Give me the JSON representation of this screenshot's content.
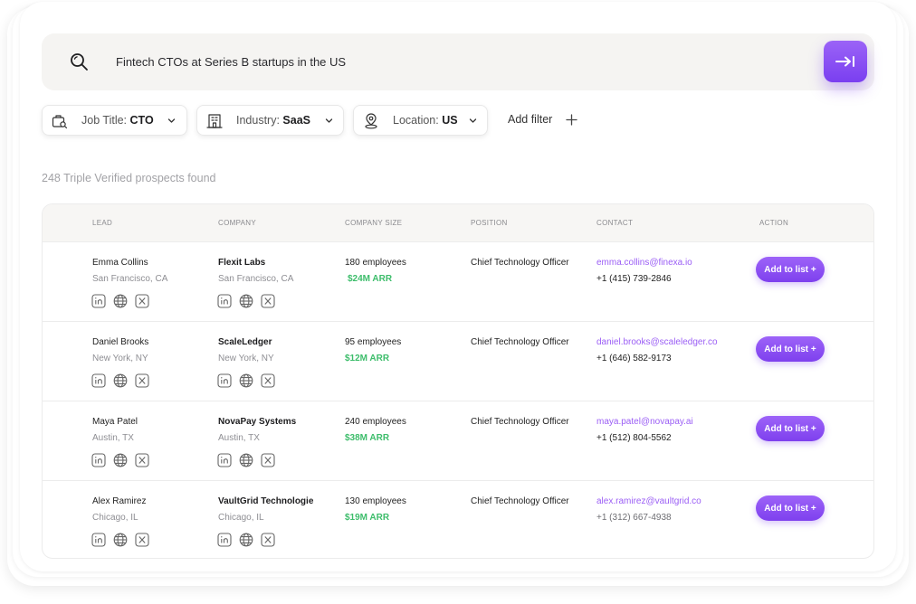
{
  "search": {
    "query": "Fintech CTOs at Series B startups in the US"
  },
  "filters": [
    {
      "label": "Job Title:",
      "value": "CTO",
      "icon": "briefcase-search-icon"
    },
    {
      "label": "Industry:",
      "value": "SaaS",
      "icon": "building-icon"
    },
    {
      "label": "Location:",
      "value": "US",
      "icon": "location-pin-icon"
    }
  ],
  "add_filter_label": "Add filter",
  "results_text": "248 Triple Verified prospects found",
  "table": {
    "headers": [
      "LEAD",
      "COMPANY",
      "COMPANY SIZE",
      "POSITION",
      "CONTACT",
      "ACTION"
    ],
    "rows": [
      {
        "name": "Emma Collins",
        "location": "San Francisco, CA",
        "company": "Flexit Labs",
        "company_location": "San Francisco, CA",
        "size": "180 employees",
        "arr": "$24M ARR",
        "position": "Chief Technology Officer",
        "email": "emma.collins@finexa.io",
        "phone": "+1 (415) 739-2846",
        "action": "Add to list +"
      },
      {
        "name": "Daniel Brooks",
        "location": "New York, NY",
        "company": "ScaleLedger",
        "company_location": "New York, NY",
        "size": "95 employees",
        "arr": "$12M ARR",
        "position": "Chief Technology Officer",
        "email": "daniel.brooks@scaleledger.co",
        "phone": "+1 (646) 582-9173",
        "action": "Add to list +"
      },
      {
        "name": "Maya Patel",
        "location": "Austin, TX",
        "company": "NovaPay Systems",
        "company_location": "Austin, TX",
        "size": "240 employees",
        "arr": "$38M ARR",
        "position": "Chief Technology Officer",
        "email": "maya.patel@novapay.ai",
        "phone": "+1 (512) 804-5562",
        "action": "Add to list +"
      },
      {
        "name": "Alex Ramirez",
        "location": "Chicago, IL",
        "company": "VaultGrid Technologie",
        "company_location": "Chicago, IL",
        "size": "130 employees",
        "arr": "$19M ARR",
        "position": "Chief Technology Officer",
        "email": "alex.ramirez@vaultgrid.co",
        "phone": "+1 (312) 667-4938",
        "action": "Add to list +"
      }
    ]
  },
  "colors": {
    "accent": "#8b4ff3",
    "arr_green": "#3dbd6b",
    "email_purple": "#9b5ef5"
  }
}
